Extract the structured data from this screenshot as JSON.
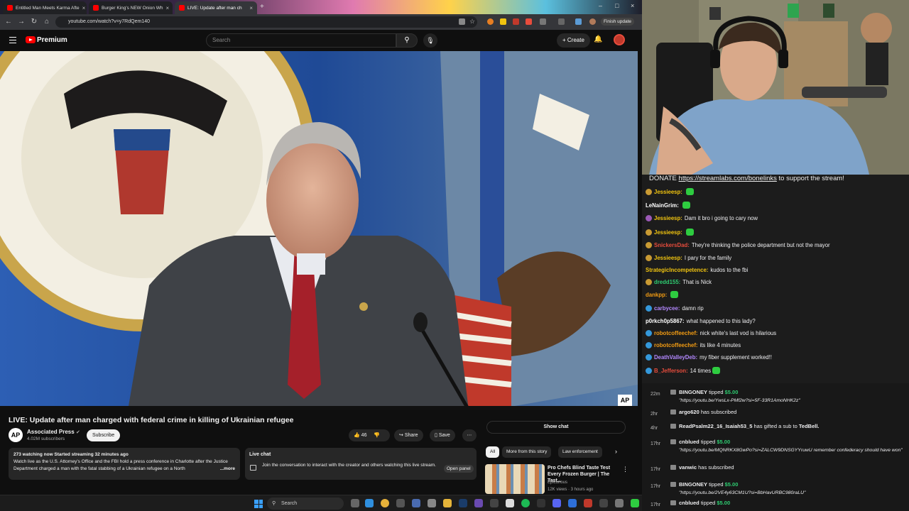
{
  "browser": {
    "tabs": [
      {
        "title": "Entitled Man Meets Karma Afte"
      },
      {
        "title": "Burger King's NEW Onion Wh"
      },
      {
        "title": "LIVE: Update after man ch"
      }
    ],
    "url": "youtube.com/watch?v=y7RdQem140",
    "finish_update": "Finish update"
  },
  "youtube": {
    "brand": "Premium",
    "search_placeholder": "Search",
    "create_label": "Create",
    "video_title": "LIVE: Update after man charged with federal crime in killing of Ukrainian refugee",
    "channel": {
      "avatar": "AP",
      "name": "Associated Press",
      "subscribers": "4.02M subscribers"
    },
    "subscribe_label": "Subscribe",
    "likes": "46",
    "share_label": "Share",
    "save_label": "Save",
    "more_label": "⋯",
    "ap_badge": "AP",
    "description": {
      "meta": "273 watching now  Started streaming 32 minutes ago",
      "text": "Watch live as the U.S. Attorney's Office and the FBI hold a press conference in Charlotte after the Justice Department charged a man with the fatal stabbing of a Ukrainian refugee on a North",
      "more": "...more"
    },
    "live_chat": {
      "title": "Live chat",
      "text": "Join the conversation to interact with the creator and others watching this live stream.",
      "open_panel": "Open panel"
    },
    "show_chat": "Show chat",
    "chips": [
      "All",
      "More from this story",
      "Law enforcement"
    ],
    "recommended": {
      "title": "Pro Chefs Blind Taste Test Every Frozen Burger | The Tast...",
      "channel": "Epicurious",
      "stats": "12K views · 3 hours ago"
    }
  },
  "taskbar": {
    "search": "Search"
  },
  "stream": {
    "donate_prefix": "DONATE ",
    "donate_link": "https://streamlabs.com/bonelinks",
    "donate_suffix": " to support the stream!",
    "chat": [
      {
        "user": "Jessieesp:",
        "msg": "",
        "color": "#f1c40f",
        "emote": true
      },
      {
        "user": "LeNainGrim:",
        "msg": "",
        "color": "#ffffff",
        "emote": true
      },
      {
        "user": "Jessieesp:",
        "msg": "Dam it bro i going to cary now",
        "color": "#f1c40f",
        "emote": false
      },
      {
        "user": "Jessieesp:",
        "msg": "",
        "color": "#f1c40f",
        "emote": true
      },
      {
        "user": "SnickersDad:",
        "msg": "They're thinking the police department but not the mayor",
        "color": "#e74c3c",
        "emote": false
      },
      {
        "user": "Jessieesp:",
        "msg": "I pary for the family",
        "color": "#f1c40f",
        "emote": false
      },
      {
        "user": "StrategicIncompetence:",
        "msg": "kudos to the fbi",
        "color": "#f1c40f",
        "emote": false
      },
      {
        "user": "dredd155:",
        "msg": "That is Nick",
        "color": "#2ecc71",
        "emote": false
      },
      {
        "user": "dankpp:",
        "msg": "",
        "color": "#f39c12",
        "emote": true
      },
      {
        "user": "carbycee:",
        "msg": "damn rip",
        "color": "#b388ff",
        "emote": false
      },
      {
        "user": "p0rkch0p5867:",
        "msg": "what happened to this lady?",
        "color": "#ffffff",
        "emote": false
      },
      {
        "user": "robotcoffeechef:",
        "msg": "nick white's last vod is hilarious",
        "color": "#f39c12",
        "emote": false
      },
      {
        "user": "robotcoffeechef:",
        "msg": "its like 4 minutes",
        "color": "#f39c12",
        "emote": false
      },
      {
        "user": "DeathValleyDeb:",
        "msg": "my fiber supplement worked!!",
        "color": "#b388ff",
        "emote": false
      },
      {
        "user": "B_Jefferson:",
        "msg": "14 times",
        "color": "#e74c3c",
        "emote": true
      }
    ],
    "alerts": [
      {
        "time": "22m",
        "name": "BINGONEY",
        "action": " tipped ",
        "amount": "$5.00",
        "msg": "\"https://youtu.be/YwsLx-PMf2w?si=5F-33R1AmoNHK2z\""
      },
      {
        "time": "2hr",
        "name": "argo620",
        "action": " has subscribed",
        "amount": "",
        "msg": ""
      },
      {
        "time": "4hr",
        "name": "ReadPsalm22_16_Isaiah53_5",
        "action": " has gifted a sub to ",
        "amount": "TedBell.",
        "msg": ""
      },
      {
        "time": "17hr",
        "name": "cnblued",
        "action": " tipped ",
        "amount": "$5.00",
        "msg": "\"https://youtu.be/MQNRKX8GwPo?si=ZALCW9DNSGYYruwU remember confederacy should have won\""
      },
      {
        "time": "17hr",
        "name": "vanwic",
        "action": " has subscribed",
        "amount": "",
        "msg": ""
      },
      {
        "time": "17hr",
        "name": "BINGONEY",
        "action": " tipped ",
        "amount": "$5.00",
        "msg": "\"https://youtu.be/2VE4y63CM1U?si=BbHavURBC980raLU\""
      },
      {
        "time": "17hr",
        "name": "cnblued",
        "action": " tipped ",
        "amount": "$5.00",
        "msg": ""
      }
    ]
  }
}
